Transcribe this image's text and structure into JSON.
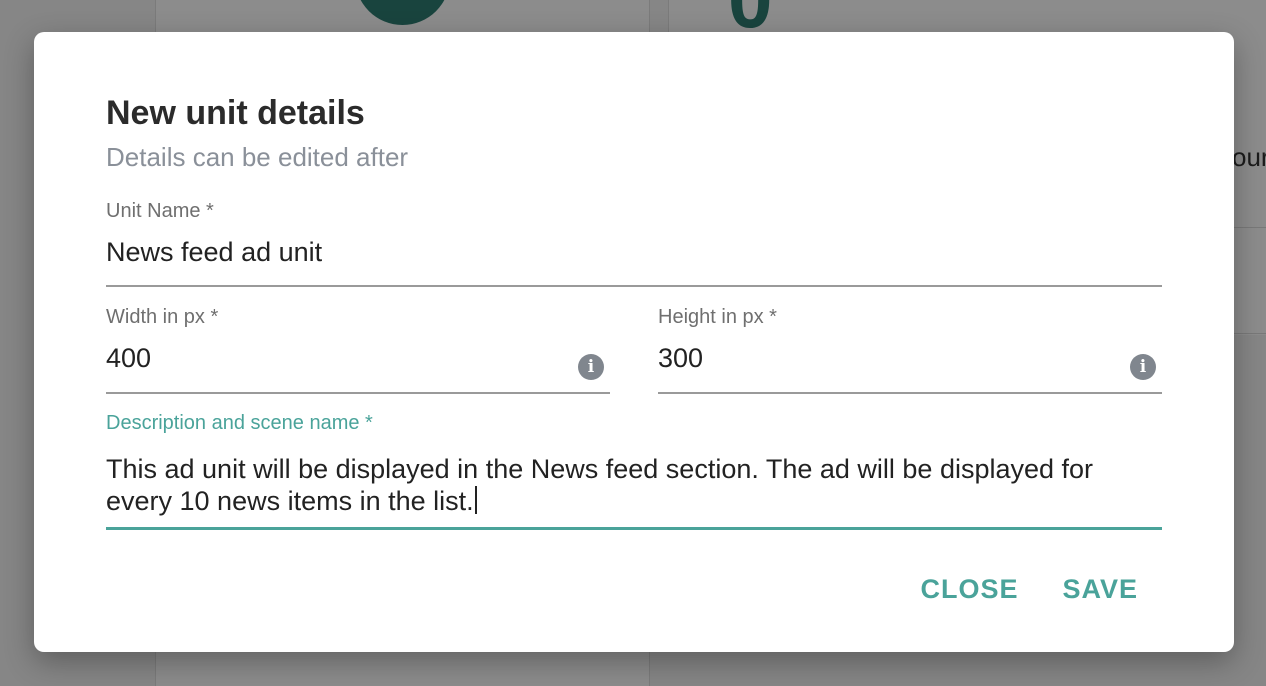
{
  "dialog": {
    "title": "New unit details",
    "subtitle": "Details can be edited after",
    "fields": {
      "unit_name": {
        "label": "Unit Name *",
        "value": "News feed ad unit"
      },
      "width": {
        "label": "Width in px *",
        "value": "400",
        "icon": "info-icon"
      },
      "height": {
        "label": "Height in px *",
        "value": "300",
        "icon": "info-icon"
      },
      "description": {
        "label": "Description and scene name *",
        "value": "This ad unit will be displayed in the News feed section. The ad will be displayed for every 10 news items in the list."
      }
    },
    "actions": {
      "close_label": "CLOSE",
      "save_label": "SAVE"
    }
  },
  "colors": {
    "accent": "#4aa39a",
    "title": "#2b2b2b",
    "subtitle": "#8a9099",
    "label": "#6f6f6f",
    "info_icon": "#80868e",
    "background_accent": "#2e7d72"
  },
  "background": {
    "digit": "0",
    "partial_text": "our"
  }
}
